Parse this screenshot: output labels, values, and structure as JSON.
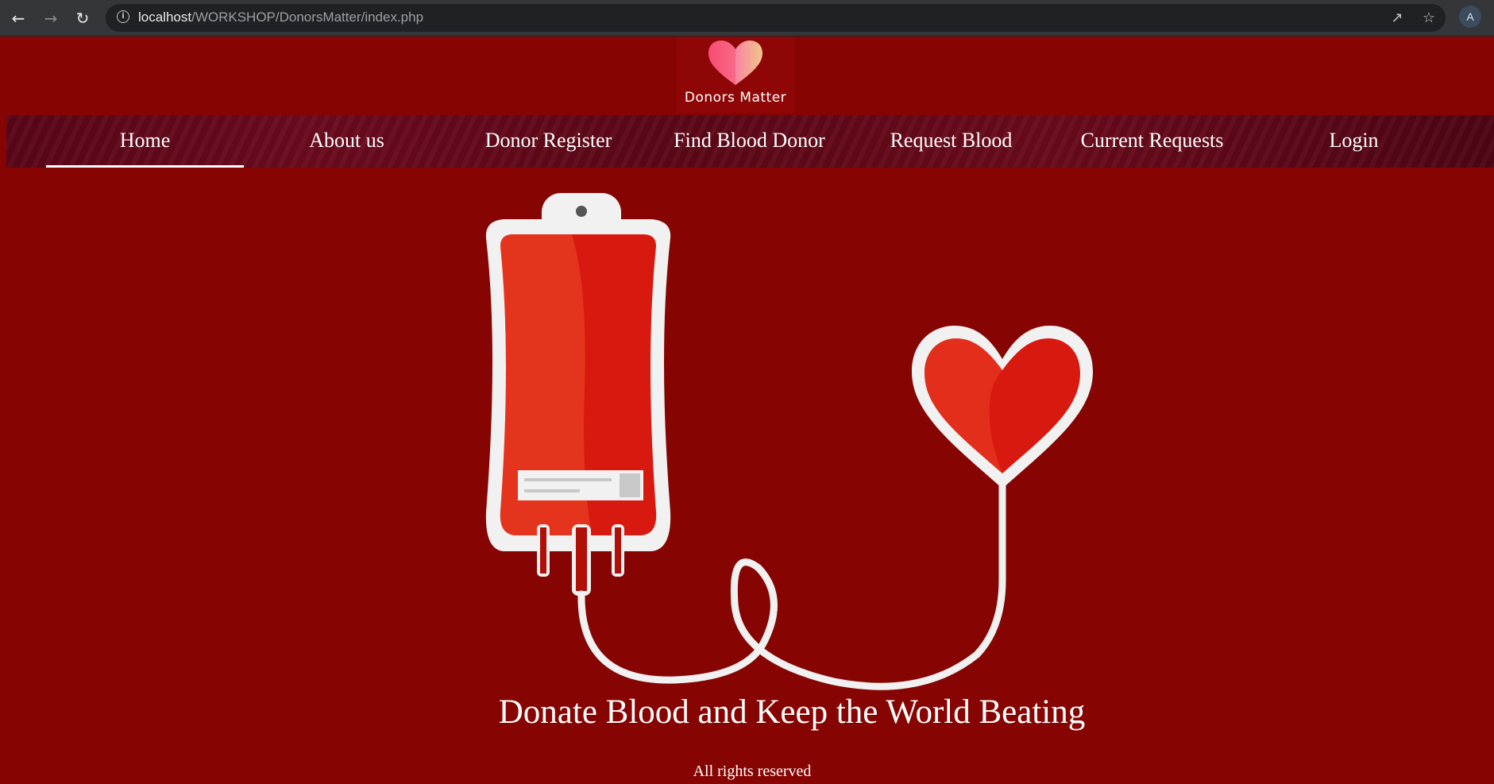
{
  "browser": {
    "url_host": "localhost",
    "url_path": "/WORKSHOP/DonorsMatter/index.php",
    "avatar_initial": "A"
  },
  "logo": {
    "brand_text": "Donors Matter"
  },
  "nav": {
    "items": [
      {
        "label": "Home",
        "active": true
      },
      {
        "label": "About us"
      },
      {
        "label": "Donor Register"
      },
      {
        "label": "Find Blood Donor"
      },
      {
        "label": "Request Blood"
      },
      {
        "label": "Current Requests"
      },
      {
        "label": "Login"
      }
    ]
  },
  "hero": {
    "tagline": "Donate Blood and Keep the World Beating"
  },
  "footer": {
    "text": "All rights reserved"
  },
  "colors": {
    "page_background": "#860503",
    "nav_background": "#5a0618",
    "blood": "#d8190f",
    "text": "#ffffff"
  }
}
